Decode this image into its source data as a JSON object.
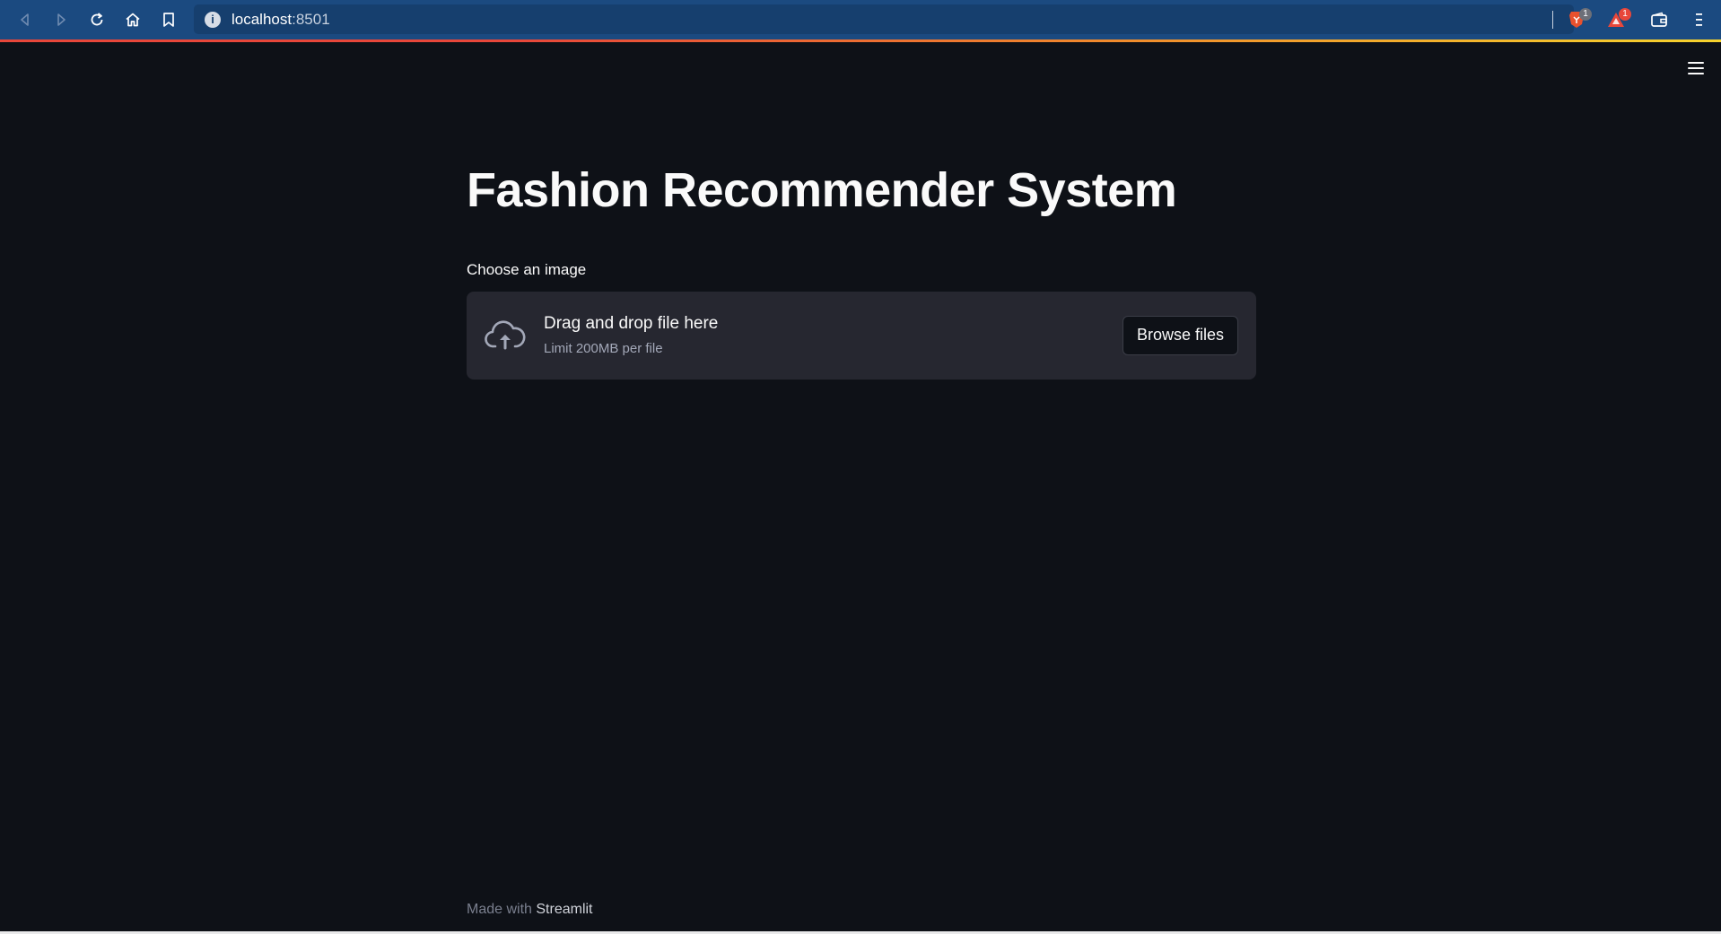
{
  "browser": {
    "url_host": "localhost",
    "url_port": ":8501",
    "info_icon": "i",
    "brave_shields_count": "1",
    "brave_rewards_count": "1"
  },
  "app": {
    "title": "Fashion Recommender System",
    "uploader": {
      "label": "Choose an image",
      "drop_text": "Drag and drop file here",
      "limit_text": "Limit 200MB per file",
      "browse_label": "Browse files"
    },
    "footer": {
      "prefix": "Made with",
      "brand": "Streamlit"
    }
  },
  "colors": {
    "background": "#0e1117",
    "dropzone": "#262730",
    "toolbar": "#1b4a80"
  }
}
